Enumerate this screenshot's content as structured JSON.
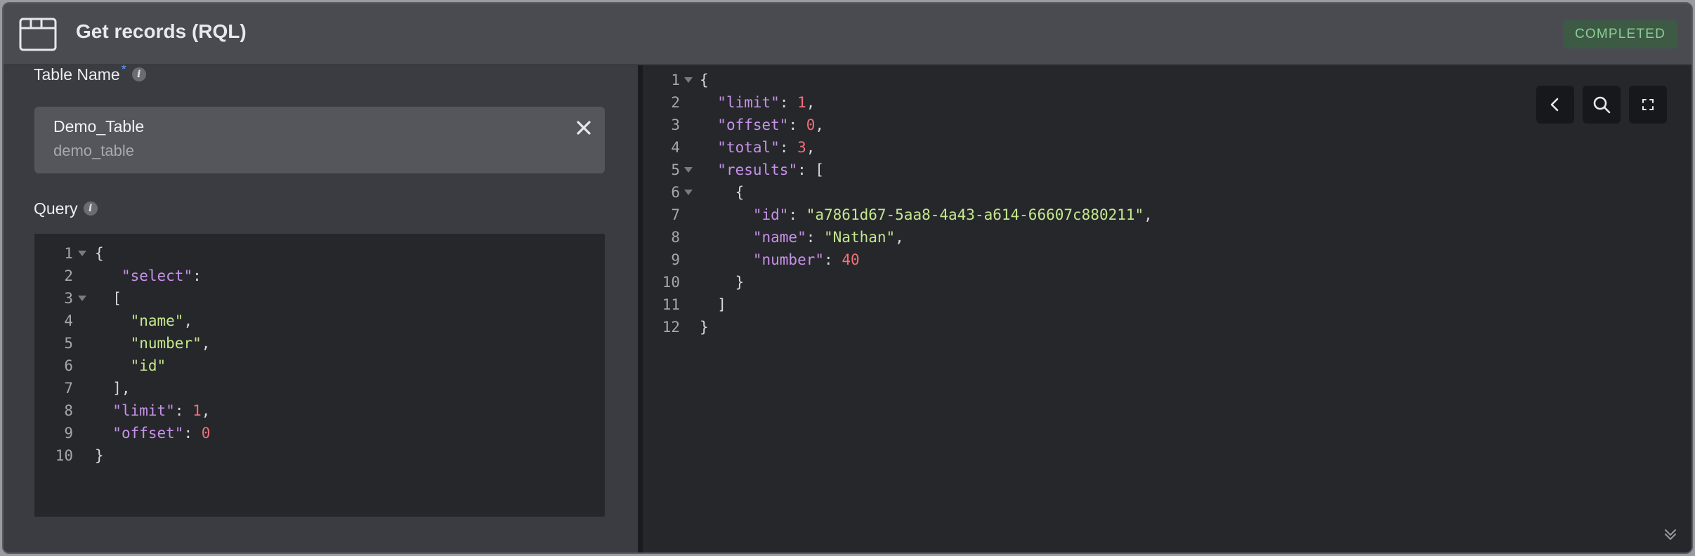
{
  "window": {
    "title": "Get records (RQL)",
    "status": "COMPLETED",
    "icon": "browser-window-icon"
  },
  "table_name": {
    "label": "Table Name",
    "required_marker": "*",
    "info_icon": "i",
    "selected_name": "Demo_Table",
    "selected_id": "demo_table",
    "clear_icon": "close-icon"
  },
  "query": {
    "label": "Query",
    "info_icon": "i",
    "line_numbers": [
      "1",
      "2",
      "3",
      "4",
      "5",
      "6",
      "7",
      "8",
      "9",
      "10"
    ],
    "lines": [
      [
        {
          "t": "p",
          "v": "{"
        }
      ],
      [
        {
          "t": "p",
          "v": "   "
        },
        {
          "t": "k",
          "v": "\"select\""
        },
        {
          "t": "p",
          "v": ":"
        }
      ],
      [
        {
          "t": "p",
          "v": "  ["
        }
      ],
      [
        {
          "t": "p",
          "v": "    "
        },
        {
          "t": "s",
          "v": "\"name\""
        },
        {
          "t": "p",
          "v": ","
        }
      ],
      [
        {
          "t": "p",
          "v": "    "
        },
        {
          "t": "s",
          "v": "\"number\""
        },
        {
          "t": "p",
          "v": ","
        }
      ],
      [
        {
          "t": "p",
          "v": "    "
        },
        {
          "t": "s",
          "v": "\"id\""
        }
      ],
      [
        {
          "t": "p",
          "v": "  ],"
        }
      ],
      [
        {
          "t": "p",
          "v": "  "
        },
        {
          "t": "k",
          "v": "\"limit\""
        },
        {
          "t": "p",
          "v": ": "
        },
        {
          "t": "n",
          "v": "1"
        },
        {
          "t": "p",
          "v": ","
        }
      ],
      [
        {
          "t": "p",
          "v": "  "
        },
        {
          "t": "k",
          "v": "\"offset\""
        },
        {
          "t": "p",
          "v": ": "
        },
        {
          "t": "n",
          "v": "0"
        }
      ],
      [
        {
          "t": "p",
          "v": "}"
        }
      ]
    ],
    "fold_lines": [
      0,
      2
    ]
  },
  "result": {
    "line_numbers": [
      "1",
      "2",
      "3",
      "4",
      "5",
      "6",
      "7",
      "8",
      "9",
      "10",
      "11",
      "12"
    ],
    "lines": [
      [
        {
          "t": "p",
          "v": "{"
        }
      ],
      [
        {
          "t": "p",
          "v": "  "
        },
        {
          "t": "k",
          "v": "\"limit\""
        },
        {
          "t": "p",
          "v": ": "
        },
        {
          "t": "n",
          "v": "1"
        },
        {
          "t": "p",
          "v": ","
        }
      ],
      [
        {
          "t": "p",
          "v": "  "
        },
        {
          "t": "k",
          "v": "\"offset\""
        },
        {
          "t": "p",
          "v": ": "
        },
        {
          "t": "n",
          "v": "0"
        },
        {
          "t": "p",
          "v": ","
        }
      ],
      [
        {
          "t": "p",
          "v": "  "
        },
        {
          "t": "k",
          "v": "\"total\""
        },
        {
          "t": "p",
          "v": ": "
        },
        {
          "t": "n",
          "v": "3"
        },
        {
          "t": "p",
          "v": ","
        }
      ],
      [
        {
          "t": "p",
          "v": "  "
        },
        {
          "t": "k",
          "v": "\"results\""
        },
        {
          "t": "p",
          "v": ": ["
        }
      ],
      [
        {
          "t": "p",
          "v": "    {"
        }
      ],
      [
        {
          "t": "p",
          "v": "      "
        },
        {
          "t": "k",
          "v": "\"id\""
        },
        {
          "t": "p",
          "v": ": "
        },
        {
          "t": "s",
          "v": "\"a7861d67-5aa8-4a43-a614-66607c880211\""
        },
        {
          "t": "p",
          "v": ","
        }
      ],
      [
        {
          "t": "p",
          "v": "      "
        },
        {
          "t": "k",
          "v": "\"name\""
        },
        {
          "t": "p",
          "v": ": "
        },
        {
          "t": "s",
          "v": "\"Nathan\""
        },
        {
          "t": "p",
          "v": ","
        }
      ],
      [
        {
          "t": "p",
          "v": "      "
        },
        {
          "t": "k",
          "v": "\"number\""
        },
        {
          "t": "p",
          "v": ": "
        },
        {
          "t": "n",
          "v": "40"
        }
      ],
      [
        {
          "t": "p",
          "v": "    }"
        }
      ],
      [
        {
          "t": "p",
          "v": "  ]"
        }
      ],
      [
        {
          "t": "p",
          "v": "}"
        }
      ]
    ],
    "fold_lines": [
      0,
      4,
      5
    ]
  },
  "toolbar": {
    "back_icon": "chevron-left-icon",
    "search_icon": "search-icon",
    "fullscreen_icon": "expand-icon"
  },
  "footer": {
    "collapse_icon": "chevrons-down-icon"
  },
  "colors": {
    "key": "#c792ea",
    "string": "#c3e88d",
    "number": "#f07178",
    "status_text": "#8ccd96",
    "required": "#5b9cf5"
  }
}
